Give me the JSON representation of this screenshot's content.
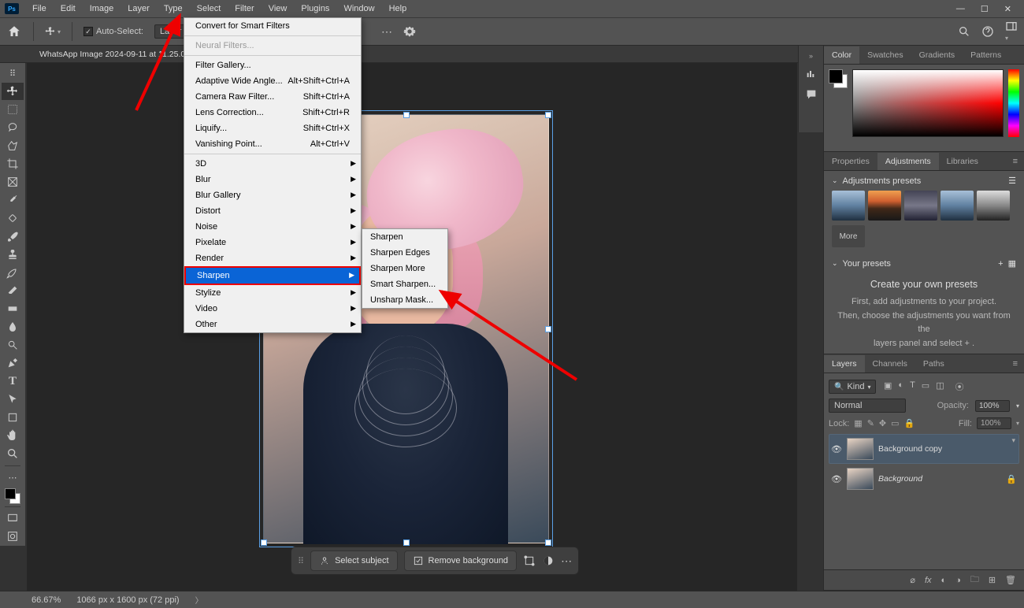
{
  "menubar": {
    "items": [
      "File",
      "Edit",
      "Image",
      "Layer",
      "Type",
      "Select",
      "Filter",
      "View",
      "Plugins",
      "Window",
      "Help"
    ]
  },
  "optionsbar": {
    "auto_select": "Auto-Select:",
    "layer": "Layer"
  },
  "doc_tab": "WhatsApp Image 2024-09-11 at 11.25.0",
  "filter_menu": {
    "convert": "Convert for Smart Filters",
    "neural": "Neural Filters...",
    "gallery": "Filter Gallery...",
    "adaptive": "Adaptive Wide Angle...",
    "adaptive_k": "Alt+Shift+Ctrl+A",
    "raw": "Camera Raw Filter...",
    "raw_k": "Shift+Ctrl+A",
    "lens": "Lens Correction...",
    "lens_k": "Shift+Ctrl+R",
    "liquify": "Liquify...",
    "liquify_k": "Shift+Ctrl+X",
    "vanish": "Vanishing Point...",
    "vanish_k": "Alt+Ctrl+V",
    "sub": [
      "3D",
      "Blur",
      "Blur Gallery",
      "Distort",
      "Noise",
      "Pixelate",
      "Render",
      "Sharpen",
      "Stylize",
      "Video",
      "Other"
    ]
  },
  "sharpen_menu": [
    "Sharpen",
    "Sharpen Edges",
    "Sharpen More",
    "Smart Sharpen...",
    "Unsharp Mask..."
  ],
  "action_bar": {
    "select_subject": "Select subject",
    "remove_bg": "Remove background"
  },
  "panels": {
    "color_tabs": [
      "Color",
      "Swatches",
      "Gradients",
      "Patterns"
    ],
    "prop_tabs": [
      "Properties",
      "Adjustments",
      "Libraries"
    ],
    "adj_presets": "Adjustments presets",
    "more": "More",
    "your_presets": "Your presets",
    "yp_title": "Create your own presets",
    "yp_l1": "First, add adjustments to your project.",
    "yp_l2": "Then, choose the adjustments you want from the",
    "yp_l3": "layers panel and select  +  .",
    "layer_tabs": [
      "Layers",
      "Channels",
      "Paths"
    ],
    "kind": "Kind",
    "blend": "Normal",
    "opacity_lbl": "Opacity:",
    "opacity": "100%",
    "lock_lbl": "Lock:",
    "fill_lbl": "Fill:",
    "fill": "100%",
    "layers": [
      {
        "name": "Background copy"
      },
      {
        "name": "Background"
      }
    ]
  },
  "status": {
    "zoom": "66.67%",
    "dims": "1066 px x 1600 px (72 ppi)"
  }
}
